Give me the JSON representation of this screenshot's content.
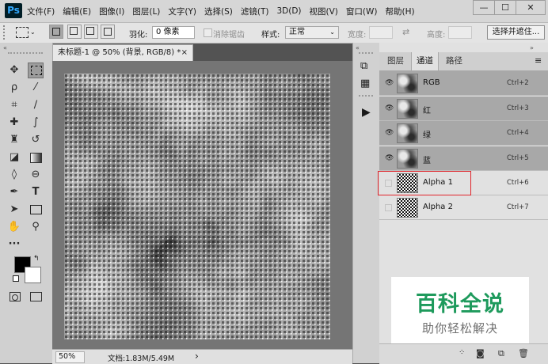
{
  "app": {
    "logo": "Ps"
  },
  "menu": [
    "文件(F)",
    "编辑(E)",
    "图像(I)",
    "图层(L)",
    "文字(Y)",
    "选择(S)",
    "滤镜(T)",
    "3D(D)",
    "视图(V)",
    "窗口(W)",
    "帮助(H)"
  ],
  "window_controls": {
    "minimize": "—",
    "maximize": "☐",
    "close": "✕"
  },
  "options": {
    "feather_label": "羽化:",
    "feather_value": "0 像素",
    "antialias_label": "消除锯齿",
    "style_label": "样式:",
    "style_value": "正常",
    "width_label": "宽度:",
    "height_label": "高度:",
    "select_mask_button": "选择并遮住..."
  },
  "document": {
    "tab_title": "未标题-1 @ 50% (背景, RGB/8) *",
    "close": "×",
    "zoom": "50%",
    "doc_info": "文档:1.83M/5.49M",
    "status_arrow": "›"
  },
  "panel": {
    "tabs": [
      "图层",
      "通道",
      "路径"
    ],
    "active_tab": 1,
    "menu_icon": "≡",
    "channels": [
      {
        "name": "RGB",
        "shortcut": "Ctrl+2",
        "visible": true,
        "selected": true,
        "thumb": "cloud"
      },
      {
        "name": "红",
        "shortcut": "Ctrl+3",
        "visible": true,
        "selected": true,
        "thumb": "cloud"
      },
      {
        "name": "绿",
        "shortcut": "Ctrl+4",
        "visible": true,
        "selected": true,
        "thumb": "cloud"
      },
      {
        "name": "蓝",
        "shortcut": "Ctrl+5",
        "visible": true,
        "selected": true,
        "thumb": "cloud"
      },
      {
        "name": "Alpha 1",
        "shortcut": "Ctrl+6",
        "visible": false,
        "selected": false,
        "thumb": "halftone",
        "highlight": true
      },
      {
        "name": "Alpha 2",
        "shortcut": "Ctrl+7",
        "visible": false,
        "selected": false,
        "thumb": "halftone"
      }
    ]
  },
  "watermark": {
    "title": "百科全说",
    "subtitle": "助你轻松解决"
  },
  "colors": {
    "highlight_box": "#e0242b",
    "watermark_green": "#1e9a5c"
  },
  "icons": {
    "toolbox": [
      "move-icon",
      "marquee-icon",
      "lasso-icon",
      "magic-wand-icon",
      "crop-icon",
      "eyedropper-icon",
      "healing-brush-icon",
      "brush-icon",
      "clone-stamp-icon",
      "history-brush-icon",
      "eraser-icon",
      "gradient-icon",
      "blur-icon",
      "dodge-icon",
      "pen-icon",
      "type-icon",
      "path-selection-icon",
      "rectangle-shape-icon",
      "hand-icon",
      "zoom-icon",
      "more-tools-icon"
    ]
  }
}
